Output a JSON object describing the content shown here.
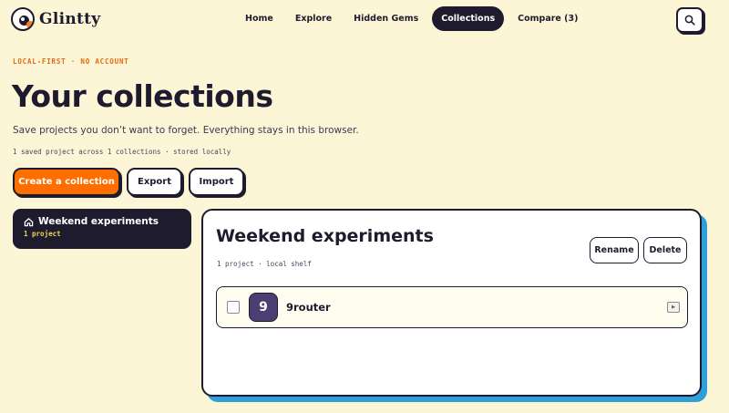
{
  "brand": {
    "name": "Glintty"
  },
  "nav": {
    "items": [
      {
        "label": "Home"
      },
      {
        "label": "Explore"
      },
      {
        "label": "Hidden Gems"
      },
      {
        "label": "Collections",
        "active": true
      },
      {
        "label": "Compare (3)"
      }
    ]
  },
  "hero": {
    "eyebrow": "LOCAL-FIRST · NO ACCOUNT",
    "title": "Your collections",
    "subtitle": "Save projects you don’t want to forget. Everything stays in this browser.",
    "stats": "1 saved project across 1 collections · stored locally",
    "create_label": "Create a collection",
    "export_label": "Export",
    "import_label": "Import"
  },
  "sidebar": {
    "collections": [
      {
        "name": "Weekend experiments",
        "count": "1 project"
      }
    ]
  },
  "panel": {
    "title": "Weekend experiments",
    "meta": "1 project · local shelf",
    "rename_label": "Rename",
    "delete_label": "Delete",
    "items": [
      {
        "initial": "9",
        "name": "9router"
      }
    ]
  },
  "colors": {
    "background": "#fdf6d6",
    "ink": "#1e1b2e",
    "accent": "#ff6f00",
    "shadow_blue": "#2e9fd8",
    "avatar": "#4b3f72"
  },
  "icons": [
    "search-icon",
    "home-icon",
    "expand-icon"
  ]
}
